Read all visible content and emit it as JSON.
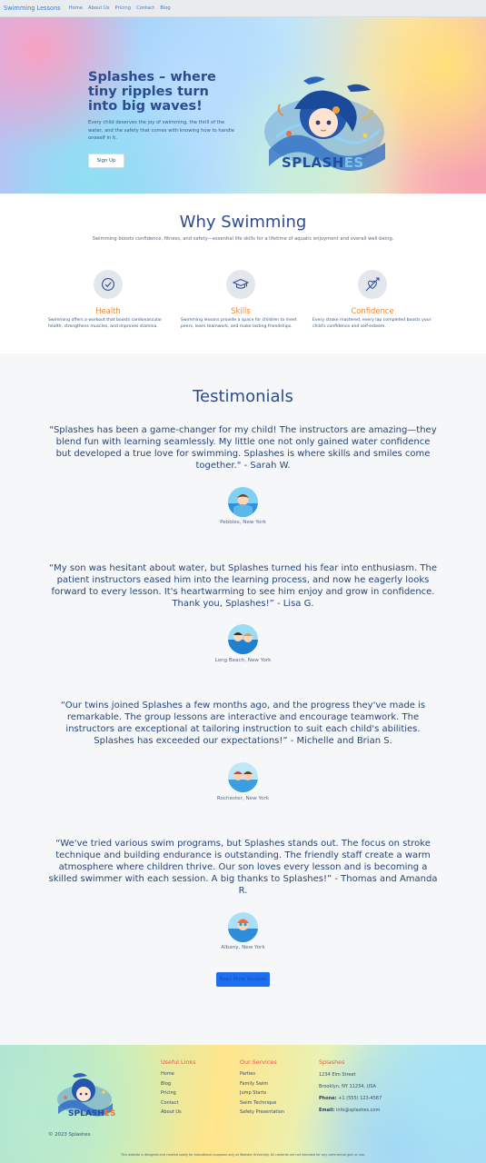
{
  "nav": {
    "brand": "Swimming Lessons",
    "links": [
      "Home",
      "About Us",
      "Pricing",
      "Contact",
      "Blog"
    ]
  },
  "hero": {
    "title": "Splashes – where tiny ripples turn into big waves!",
    "text": "Every child deserves the joy of swimming, the thrill of the water, and the safety that comes with knowing how to handle oneself in it.",
    "cta": "Sign Up",
    "logo_main": "SPLASH",
    "logo_accent": "ES"
  },
  "why": {
    "title": "Why Swimming",
    "subtitle": "Swimming boosts confidence, fitness, and safety—essential life skills for a lifetime of aquatic enjoyment and overall well-being.",
    "features": [
      {
        "title": "Health",
        "icon": "check-circle-icon",
        "text": "Swimming offers a workout that boosts cardiovascular health, strengthens muscles, and improves stamina."
      },
      {
        "title": "Skills",
        "icon": "graduation-cap-icon",
        "text": "Swimming lessons provide a space for children to meet peers, learn teamwork, and make lasting friendships."
      },
      {
        "title": "Confidence",
        "icon": "heart-arrow-icon",
        "text": "Every stroke mastered, every lap completed boosts your child's confidence and self-esteem."
      }
    ]
  },
  "testimonials": {
    "title": "Testimonials",
    "items": [
      {
        "quote": "\"Splashes has been a game-changer for my child! The instructors are amazing—they blend fun with learning seamlessly. My little one not only gained water confidence but developed a true love for swimming. Splashes is where skills and smiles come together.\" - Sarah W.",
        "location": "Pebbles, New York"
      },
      {
        "quote": "“My son was hesitant about water, but Splashes turned his fear into enthusiasm. The patient instructors eased him into the learning process, and now he eagerly looks forward to every lesson. It's heartwarming to see him enjoy and grow in confidence. Thank you, Splashes!” - Lisa G.",
        "location": "Long Beach, New York"
      },
      {
        "quote": "“Our twins joined Splashes a few months ago, and the progress they've made is remarkable. The group lessons are interactive and encourage teamwork. The instructors are exceptional at tailoring instruction to suit each child's abilities. Splashes has exceeded our expectations!” - Michelle and Brian S.",
        "location": "Rochester, New York"
      },
      {
        "quote": "“We've tried various swim programs, but Splashes stands out. The focus on stroke technique and building endurance is outstanding. The friendly staff create a warm atmosphere where children thrive. Our son loves every lesson and is becoming a skilled swimmer with each session. A big thanks to Splashes!” - Thomas and Amanda R.",
        "location": "Albany, New York"
      }
    ],
    "read_more": "Read More Reviews"
  },
  "footer": {
    "logo_main": "SPLASH",
    "logo_accent": "ES",
    "copyright": "© 2023 Splashes",
    "useful_links": {
      "title": "Useful Links",
      "items": [
        "Home",
        "Blog",
        "Pricing",
        "Contact",
        "About Us"
      ]
    },
    "services": {
      "title": "Our Services",
      "items": [
        "Parties",
        "Family Swim",
        "Jump Starts",
        "Swim Technique",
        "Safety Presentation"
      ]
    },
    "contact": {
      "title": "Splashes",
      "street": "1234 Elm Street",
      "city": "Brooklyn, NY 11234, USA",
      "phone_label": "Phone:",
      "phone": "+1 (555) 123-4567",
      "email_label": "Email:",
      "email": "info@splashes.com"
    },
    "disclaimer": "This website is designed and created solely for educational purposes only at Webster University. All contents are not intended for any commercial gain or use."
  }
}
